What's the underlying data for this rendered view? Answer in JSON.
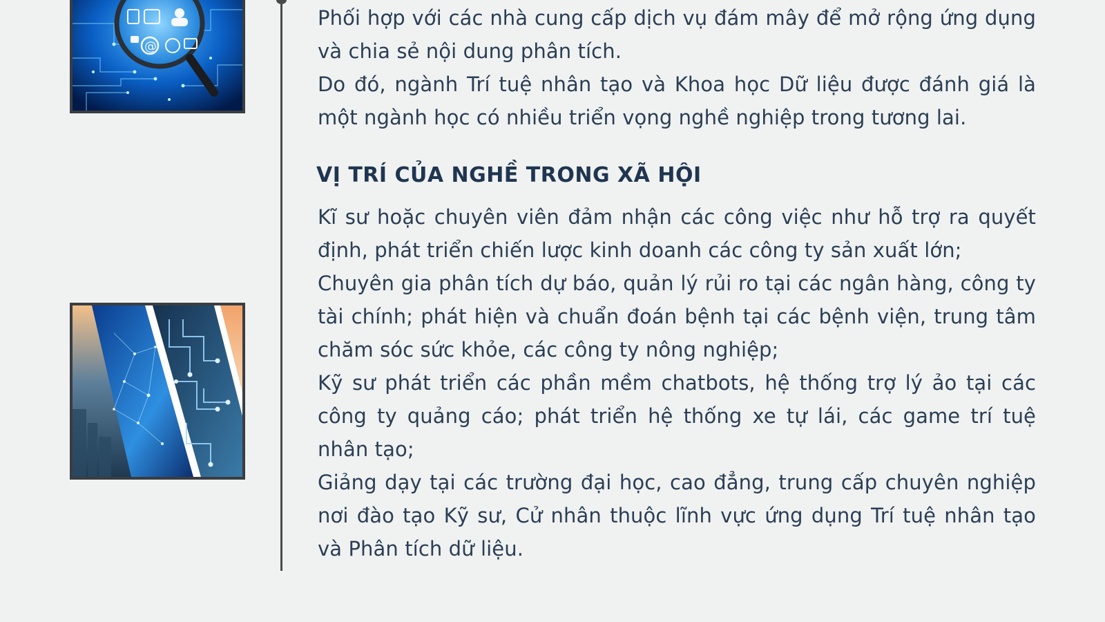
{
  "intro": {
    "paragraphs": [
      "Phối hợp với các nhà cung cấp dịch vụ đám mây để mở rộng ứng dụng và chia sẻ nội dung phân tích.",
      "Do đó, ngành Trí tuệ nhân tạo và Khoa học Dữ liệu được đánh giá là một ngành học có nhiều triển vọng nghề nghiệp trong tương lai."
    ]
  },
  "section": {
    "heading": "VỊ TRÍ CỦA NGHỀ TRONG XÃ HỘI",
    "paragraphs": [
      "Kĩ sư hoặc chuyên viên đảm nhận các công việc như hỗ trợ ra quyết định, phát triển chiến lược kinh doanh các công ty sản xuất lớn;",
      "Chuyên gia phân tích dự báo, quản lý rủi ro tại các ngân hàng, công ty tài chính; phát hiện và chuẩn đoán bệnh tại các bệnh viện, trung tâm chăm sóc sức khỏe, các công ty nông  nghiệp;",
      "Kỹ sư phát  triển  các  phần mềm chatbots, hệ  thống  trợ  lý ảo tại các công  ty quảng cáo; phát triển  hệ  thống  xe tự  lái, các game trí tuệ nhân tạo;",
      "Giảng dạy tại các trường đại học, cao đẳng, trung cấp chuyên nghiệp nơi đào tạo Kỹ sư, Cử nhân thuộc lĩnh vực ứng dụng Trí tuệ nhân tạo và Phân tích dữ liệu."
    ]
  },
  "images": [
    {
      "icon": "magnifier-network-image"
    },
    {
      "icon": "data-circuit-collage-image"
    }
  ],
  "colors": {
    "background": "#f0f2f1",
    "text": "#2b3e55",
    "heading": "#1f3550",
    "timeline": "#4a4a4a"
  }
}
